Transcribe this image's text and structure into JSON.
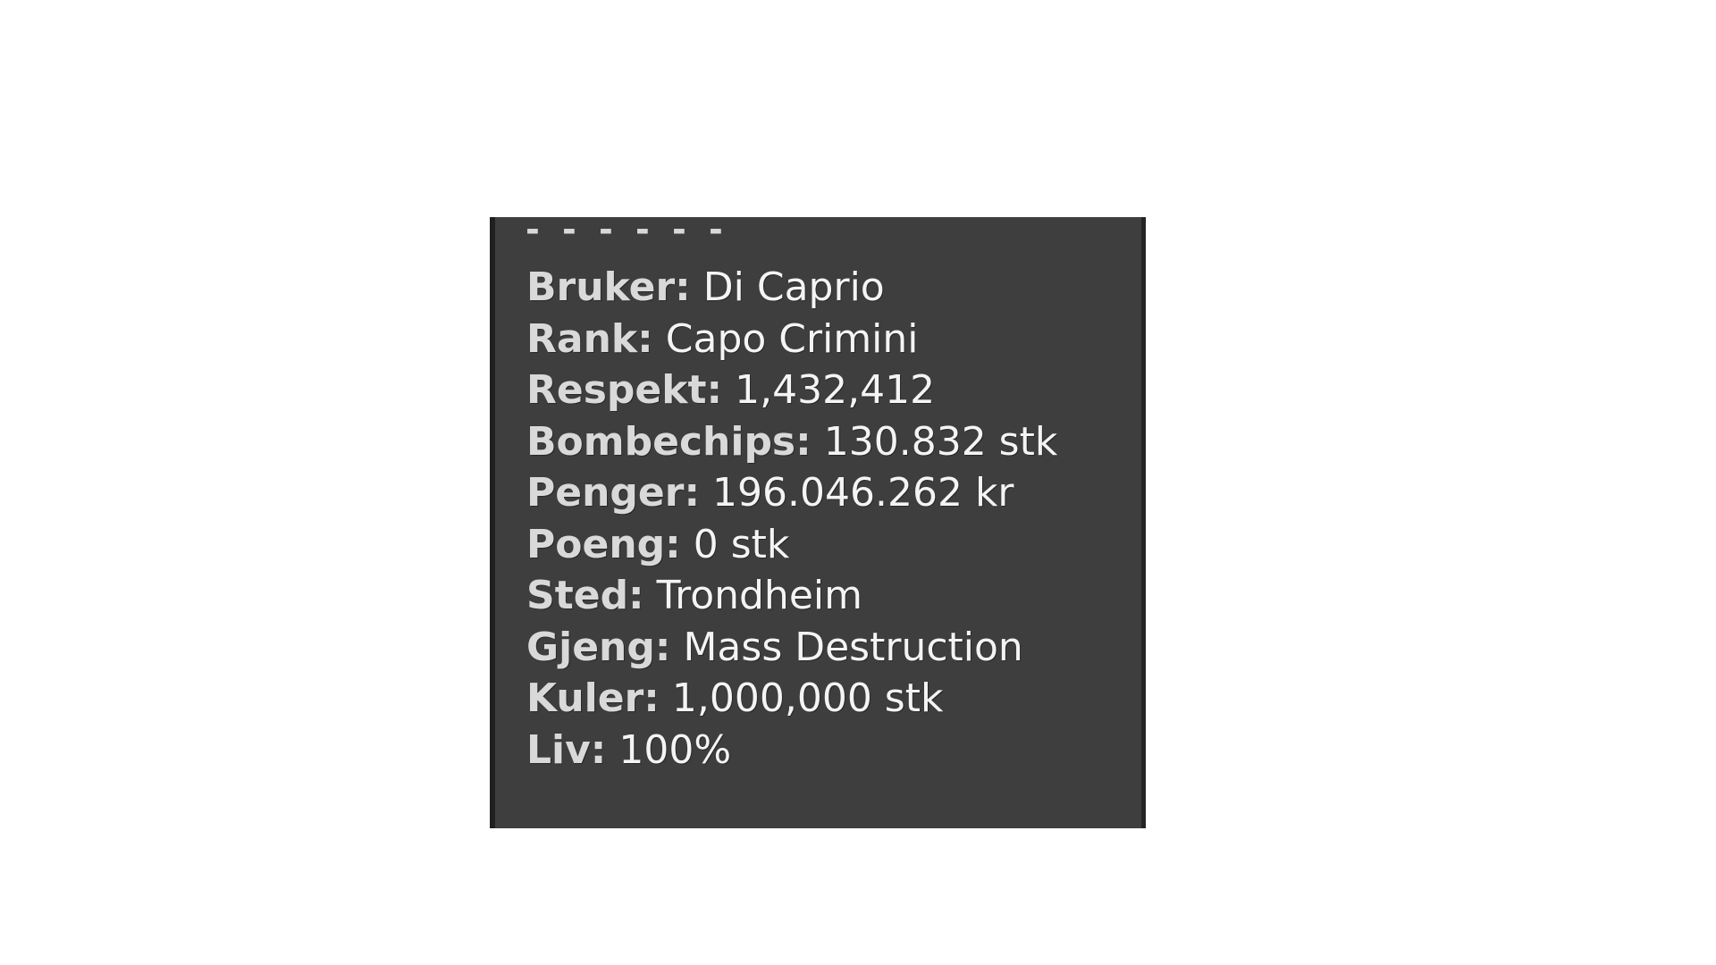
{
  "panel": {
    "separator": "- - - - - -",
    "stats": [
      {
        "label": "Bruker:",
        "value": "Di Caprio"
      },
      {
        "label": "Rank:",
        "value": "Capo Crimini"
      },
      {
        "label": "Respekt:",
        "value": "1,432,412"
      },
      {
        "label": "Bombechips:",
        "value": "130.832 stk"
      },
      {
        "label": "Penger:",
        "value": "196.046.262 kr"
      },
      {
        "label": "Poeng:",
        "value": "0 stk"
      },
      {
        "label": "Sted:",
        "value": "Trondheim"
      },
      {
        "label": "Gjeng:",
        "value": "Mass Destruction"
      },
      {
        "label": "Kuler:",
        "value": "1,000,000 stk"
      },
      {
        "label": "Liv:",
        "value": "100%"
      }
    ]
  }
}
